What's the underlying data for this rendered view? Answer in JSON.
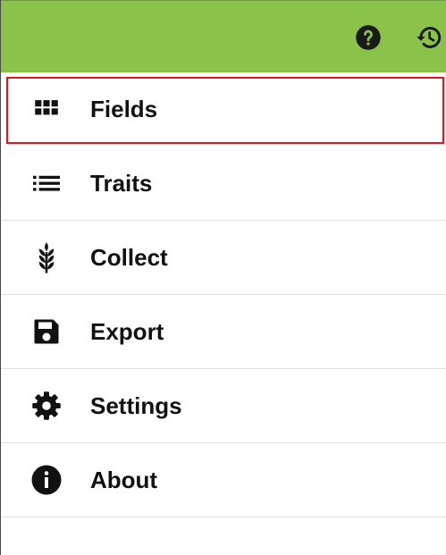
{
  "topbar": {
    "background": "#8bc34a",
    "actions": [
      {
        "icon": "help-icon"
      },
      {
        "icon": "history-icon"
      }
    ]
  },
  "menu": {
    "selected_index": 0,
    "highlight_color": "#e0141e",
    "items": [
      {
        "label": "Fields",
        "icon": "grid-icon"
      },
      {
        "label": "Traits",
        "icon": "list-icon"
      },
      {
        "label": "Collect",
        "icon": "wheat-icon"
      },
      {
        "label": "Export",
        "icon": "save-icon"
      },
      {
        "label": "Settings",
        "icon": "gear-icon"
      },
      {
        "label": "About",
        "icon": "info-icon"
      }
    ]
  }
}
